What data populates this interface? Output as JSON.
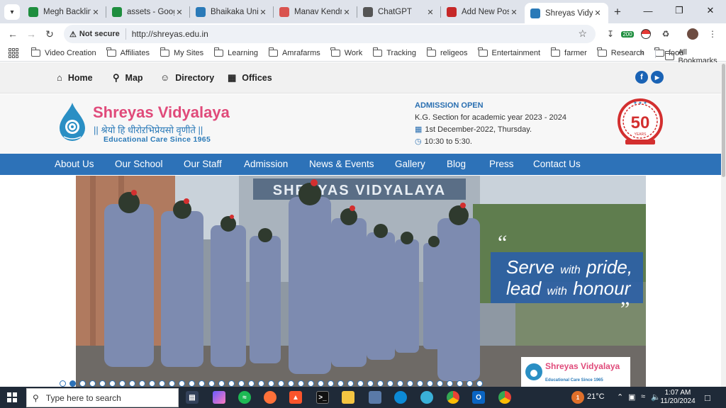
{
  "browser": {
    "tabs": [
      {
        "label": "Megh Backlinks",
        "favicon_color": "#1e8e3e",
        "favicon_icon": "sheets-icon"
      },
      {
        "label": "assets - Google",
        "favicon_color": "#1e8e3e",
        "favicon_icon": "sheets-icon"
      },
      {
        "label": "Bhaikaka Univer",
        "favicon_color": "#2a7ab8",
        "favicon_icon": "university-icon"
      },
      {
        "label": "Manav Kendra G",
        "favicon_color": "#d9534f",
        "favicon_icon": "kendra-icon"
      },
      {
        "label": "ChatGPT",
        "favicon_color": "#555555",
        "favicon_icon": "chatgpt-icon"
      },
      {
        "label": "Add New Post ‹",
        "favicon_color": "#c62828",
        "favicon_icon": "post-icon"
      },
      {
        "label": "Shreyas Vidyalay",
        "favicon_color": "#2a7ab8",
        "favicon_icon": "shreyas-icon",
        "active": true
      }
    ],
    "address": {
      "security_label": "Not secure",
      "url": "http://shreyas.edu.in"
    },
    "extension_badge": "200",
    "bookmarks": [
      "Video Creation",
      "Affiliates",
      "My Sites",
      "Learning",
      "Amrafarms",
      "Work",
      "Tracking",
      "religeos",
      "Entertainment",
      "farmer",
      "Research",
      "food"
    ],
    "all_bookmarks_label": "All Bookmarks"
  },
  "site": {
    "topnav": [
      {
        "label": "Home",
        "icon": "home-icon"
      },
      {
        "label": "Map",
        "icon": "map-pin-icon"
      },
      {
        "label": "Directory",
        "icon": "user-icon"
      },
      {
        "label": "Offices",
        "icon": "building-icon"
      }
    ],
    "social": {
      "facebook": "f",
      "youtube": "▶"
    },
    "brand": {
      "name": "Shreyas Vidyalaya",
      "tagline_devanagari": "|| श्रेयो हि धीरोऱभिप्रेयसो वृणीते ||",
      "tagline_english": "Educational Care Since 1965"
    },
    "admission": {
      "title": "ADMISSION OPEN",
      "subtitle": "K.G. Section for academic year 2023 - 2024",
      "date": "1st December-2022, Thursday.",
      "time": "10:30 to 5:30."
    },
    "emblem": {
      "number": "50",
      "caption": "YEARS"
    },
    "mainnav": [
      "About Us",
      "Our School",
      "Our Staff",
      "Admission",
      "News & Events",
      "Gallery",
      "Blog",
      "Press",
      "Contact Us"
    ],
    "hero": {
      "building_sign": "SHREYAS VIDYALAYA",
      "quote_line1_strong": "Serve",
      "quote_line1_small": "with",
      "quote_line1_end": "pride,",
      "quote_line2_strong": "lead",
      "quote_line2_small": "with",
      "quote_line2_end": "honour",
      "badge_name": "Shreyas Vidyalaya",
      "badge_caption": "Educational Care Since 1965"
    },
    "slider_dot_count": 43,
    "slider_active_index": 1
  },
  "taskbar": {
    "search_placeholder": "Type here to search",
    "weather": "21°C",
    "time": "1:07 AM",
    "date": "11/20/2024",
    "notification_count": "1"
  },
  "colors": {
    "brand_pink": "#e04a7a",
    "brand_blue": "#2d72b8",
    "taskbar": "#1f2a38"
  }
}
